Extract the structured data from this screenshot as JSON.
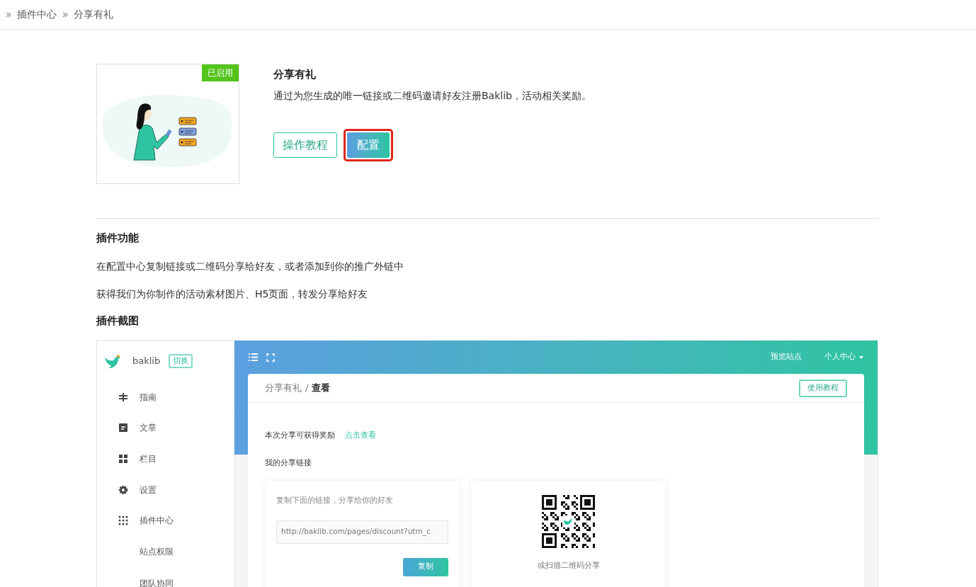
{
  "breadcrumb": [
    {
      "label": "插件中心"
    },
    {
      "label": "分享有礼"
    }
  ],
  "plugin": {
    "badge": "已启用",
    "enabled": true,
    "title": "分享有礼",
    "description": "通过为您生成的唯一链接或二维码邀请好友注册Baklib，活动相关奖励。",
    "buttons": [
      {
        "label": "操作教程",
        "kind": "outline",
        "highlighted": false
      },
      {
        "label": "配置",
        "kind": "primary",
        "highlighted": true
      }
    ]
  },
  "features": {
    "heading": "插件功能",
    "items": [
      "在配置中心复制链接或二维码分享给好友，或者添加到你的推广外链中",
      "获得我们为你制作的活动素材图片、H5页面，转发分享给好友"
    ]
  },
  "screenshot": {
    "heading": "插件截图",
    "sidebar": {
      "brand": "baklib",
      "switch_button": "切换",
      "items": [
        {
          "label": "指南",
          "kind": "main"
        },
        {
          "label": "文章",
          "kind": "main"
        },
        {
          "label": "栏目",
          "kind": "main"
        },
        {
          "label": "设置",
          "kind": "main"
        },
        {
          "label": "插件中心",
          "kind": "main"
        },
        {
          "label": "站点权限",
          "kind": "sub"
        },
        {
          "label": "团队协同",
          "kind": "sub"
        }
      ]
    },
    "header": {
      "links": [
        {
          "label": "预览站点",
          "dropdown": false
        },
        {
          "label": "个人中心",
          "dropdown": true
        }
      ]
    },
    "card": {
      "breadcrumb_parent": "分享有礼",
      "breadcrumb_separator": "/",
      "breadcrumb_current": "查看",
      "tutorial_button": "使用教程",
      "reward_label": "本次分享可获得奖励",
      "reward_link": "点击查看",
      "link_heading": "我的分享链接",
      "link_hint": "复制下面的链接，分享给你的好友",
      "link_value": "http://baklib.com/pages/discount?utm_c",
      "copy_button": "复制",
      "qr_caption": "或扫描二维码分享"
    }
  }
}
